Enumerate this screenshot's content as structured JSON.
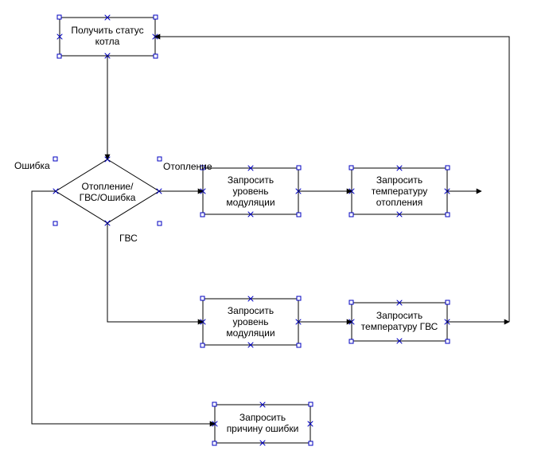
{
  "nodes": {
    "get_status": {
      "line1": "Получить статус",
      "line2": "котла"
    },
    "decision": {
      "line1": "Отопление/",
      "line2": "ГВС/Ошибка"
    },
    "req_mod_1": {
      "line1": "Запросить",
      "line2": "уровень",
      "line3": "модуляции"
    },
    "req_heat": {
      "line1": "Запросить",
      "line2": "температуру",
      "line3": "отопления"
    },
    "req_mod_2": {
      "line1": "Запросить",
      "line2": "уровень",
      "line3": "модуляции"
    },
    "req_dhw": {
      "line1": "Запросить",
      "line2": "температуру ГВС"
    },
    "req_error": {
      "line1": "Запросить",
      "line2": "причину ошибки"
    }
  },
  "edge_labels": {
    "error": "Ошибка",
    "heating": "Отопление",
    "dhw": "ГВС"
  }
}
